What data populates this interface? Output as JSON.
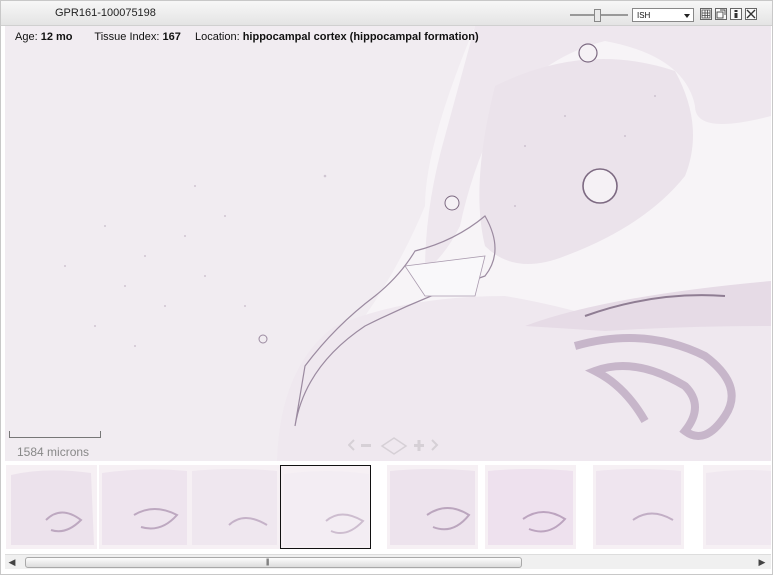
{
  "window": {
    "title": "GPR161-100075198"
  },
  "toolbar": {
    "zoom_slider_level": 0.45,
    "view_mode": "ISH",
    "buttons": [
      "grid-icon",
      "expand-icon",
      "info-icon",
      "close-icon"
    ]
  },
  "meta": {
    "age_label": "Age:",
    "age_value": "12 mo",
    "tissue_label": "Tissue Index:",
    "tissue_value": "167",
    "location_label": "Location:",
    "location_value": "hippocampal cortex (hippocampal formation)"
  },
  "scale": {
    "label": "1584 microns"
  },
  "navigation": {
    "icons": [
      "left-arrow-icon",
      "zoom-out-icon",
      "pan-icon",
      "zoom-in-icon",
      "right-arrow-icon"
    ]
  },
  "thumbnails": {
    "count": 8,
    "selected_index": 3
  },
  "colors": {
    "tissue": "#ece4ec",
    "stain": "#9b8aa0",
    "background": "#f7f4f7"
  }
}
